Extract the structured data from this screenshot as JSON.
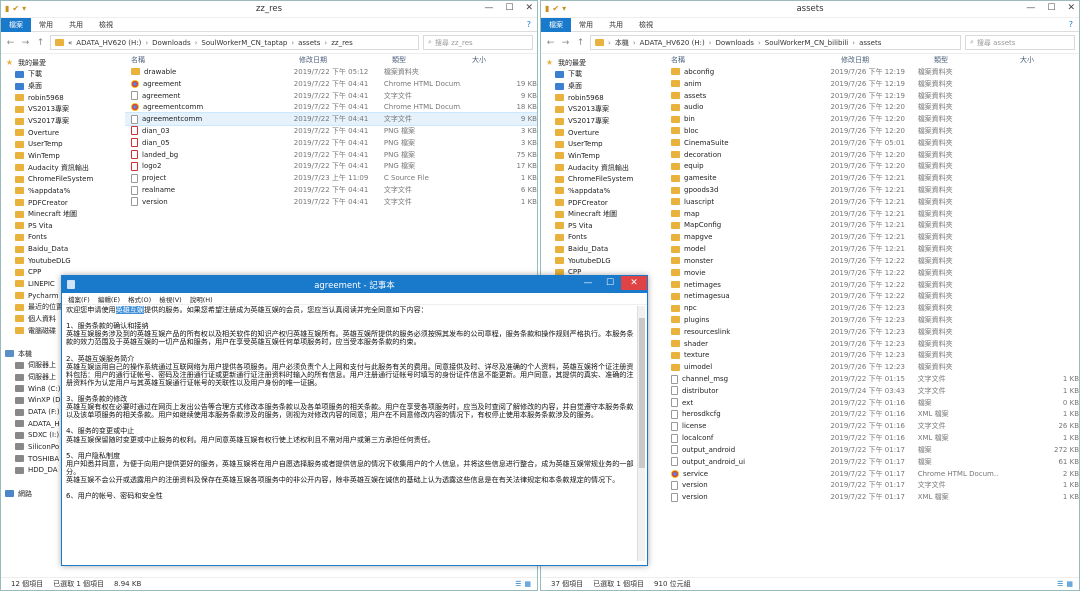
{
  "left": {
    "title": "zz_res",
    "ribbon": [
      "檔案",
      "常用",
      "共用",
      "檢視"
    ],
    "path": [
      "«",
      "ADATA_HV620 (H:)",
      "Downloads",
      "SoulWorkerM_CN_taptap",
      "assets",
      "zz_res"
    ],
    "search_placeholder": "搜尋 zz_res",
    "headers": {
      "name": "名稱",
      "date": "修改日期",
      "type": "類型",
      "size": "大小"
    },
    "nav": [
      "我的最愛",
      "下載",
      "桌面",
      "robin5968",
      "VS2013專案",
      "VS2017專案",
      "Overture",
      "UserTemp",
      "WinTemp",
      "Audacity 資訊輸出",
      "ChromeFileSystem",
      "%appdata%",
      "PDFCreator",
      "Minecraft 地圖",
      "PS Vita",
      "Fonts",
      "Baidu_Data",
      "YoutubeDLG",
      "CPP",
      "LINEPIC",
      "Pycharm",
      "最近的位置",
      "個人資料",
      "電腦磁碟",
      "",
      "本機",
      "伺服器上",
      "伺服器上",
      "Win8 (C:)",
      "WinXP (D:)",
      "DATA (F:)",
      "ADATA_H",
      "SDXC (I:)",
      "SiliconPo",
      "TOSHIBA",
      "HDD_DA",
      "",
      "網路"
    ],
    "files": [
      {
        "name": "drawable",
        "date": "2019/7/22 下午 05:12",
        "type": "檔案資料夾",
        "size": "",
        "icon": "folder"
      },
      {
        "name": "agreement",
        "date": "2019/7/22 下午 04:41",
        "type": "Chrome HTML Docum...",
        "size": "19 KB",
        "icon": "chrome"
      },
      {
        "name": "agreement",
        "date": "2019/7/22 下午 04:41",
        "type": "文字文件",
        "size": "9 KB",
        "icon": "file"
      },
      {
        "name": "agreementcomm",
        "date": "2019/7/22 下午 04:41",
        "type": "Chrome HTML Docum...",
        "size": "18 KB",
        "icon": "chrome"
      },
      {
        "name": "agreementcomm",
        "date": "2019/7/22 下午 04:41",
        "type": "文字文件",
        "size": "9 KB",
        "icon": "file",
        "selected": true
      },
      {
        "name": "dian_03",
        "date": "2019/7/22 下午 04:41",
        "type": "PNG 檔案",
        "size": "3 KB",
        "icon": "png"
      },
      {
        "name": "dian_05",
        "date": "2019/7/22 下午 04:41",
        "type": "PNG 檔案",
        "size": "3 KB",
        "icon": "png"
      },
      {
        "name": "landed_bg",
        "date": "2019/7/22 下午 04:41",
        "type": "PNG 檔案",
        "size": "75 KB",
        "icon": "png"
      },
      {
        "name": "logo2",
        "date": "2019/7/22 下午 04:41",
        "type": "PNG 檔案",
        "size": "17 KB",
        "icon": "png"
      },
      {
        "name": "project",
        "date": "2019/7/23 上午 11:09",
        "type": "C Source File",
        "size": "1 KB",
        "icon": "file"
      },
      {
        "name": "realname",
        "date": "2019/7/22 下午 04:41",
        "type": "文字文件",
        "size": "6 KB",
        "icon": "file"
      },
      {
        "name": "version",
        "date": "2019/7/22 下午 04:41",
        "type": "文字文件",
        "size": "1 KB",
        "icon": "file"
      }
    ],
    "status": {
      "count": "12 個項目",
      "selected": "已選取 1 個項目",
      "size": "8.94 KB"
    }
  },
  "right": {
    "title": "assets",
    "ribbon": [
      "檔案",
      "常用",
      "共用",
      "檢視"
    ],
    "path": [
      "本機",
      "ADATA_HV620 (H:)",
      "Downloads",
      "SoulWorkerM_CN_bilibili",
      "assets"
    ],
    "search_placeholder": "搜尋 assets",
    "headers": {
      "name": "名稱",
      "date": "修改日期",
      "type": "類型",
      "size": "大小"
    },
    "nav": [
      "我的最愛",
      "下載",
      "桌面",
      "robin5968",
      "VS2013專案",
      "VS2017專案",
      "Overture",
      "UserTemp",
      "WinTemp",
      "Audacity 資訊輸出",
      "ChromeFileSystem",
      "%appdata%",
      "PDFCreator",
      "Minecraft 地圖",
      "PS Vita",
      "Fonts",
      "Baidu_Data",
      "YoutubeDLG",
      "CPP"
    ],
    "files": [
      {
        "name": "abconfig",
        "date": "2019/7/26 下午 12:19",
        "type": "檔案資料夾",
        "size": "",
        "icon": "folder"
      },
      {
        "name": "anim",
        "date": "2019/7/26 下午 12:19",
        "type": "檔案資料夾",
        "size": "",
        "icon": "folder"
      },
      {
        "name": "assets",
        "date": "2019/7/26 下午 12:19",
        "type": "檔案資料夾",
        "size": "",
        "icon": "folder"
      },
      {
        "name": "audio",
        "date": "2019/7/26 下午 12:20",
        "type": "檔案資料夾",
        "size": "",
        "icon": "folder"
      },
      {
        "name": "bin",
        "date": "2019/7/26 下午 12:20",
        "type": "檔案資料夾",
        "size": "",
        "icon": "folder"
      },
      {
        "name": "bloc",
        "date": "2019/7/26 下午 12:20",
        "type": "檔案資料夾",
        "size": "",
        "icon": "folder"
      },
      {
        "name": "CinemaSuite",
        "date": "2019/7/26 下午 05:01",
        "type": "檔案資料夾",
        "size": "",
        "icon": "folder"
      },
      {
        "name": "decoration",
        "date": "2019/7/26 下午 12:20",
        "type": "檔案資料夾",
        "size": "",
        "icon": "folder"
      },
      {
        "name": "equip",
        "date": "2019/7/26 下午 12:20",
        "type": "檔案資料夾",
        "size": "",
        "icon": "folder"
      },
      {
        "name": "gamesite",
        "date": "2019/7/26 下午 12:21",
        "type": "檔案資料夾",
        "size": "",
        "icon": "folder"
      },
      {
        "name": "gpoods3d",
        "date": "2019/7/26 下午 12:21",
        "type": "檔案資料夾",
        "size": "",
        "icon": "folder"
      },
      {
        "name": "luascript",
        "date": "2019/7/26 下午 12:21",
        "type": "檔案資料夾",
        "size": "",
        "icon": "folder"
      },
      {
        "name": "map",
        "date": "2019/7/26 下午 12:21",
        "type": "檔案資料夾",
        "size": "",
        "icon": "folder"
      },
      {
        "name": "MapConfig",
        "date": "2019/7/26 下午 12:21",
        "type": "檔案資料夾",
        "size": "",
        "icon": "folder"
      },
      {
        "name": "mapgve",
        "date": "2019/7/26 下午 12:21",
        "type": "檔案資料夾",
        "size": "",
        "icon": "folder"
      },
      {
        "name": "model",
        "date": "2019/7/26 下午 12:21",
        "type": "檔案資料夾",
        "size": "",
        "icon": "folder"
      },
      {
        "name": "monster",
        "date": "2019/7/26 下午 12:22",
        "type": "檔案資料夾",
        "size": "",
        "icon": "folder"
      },
      {
        "name": "movie",
        "date": "2019/7/26 下午 12:22",
        "type": "檔案資料夾",
        "size": "",
        "icon": "folder"
      },
      {
        "name": "netimages",
        "date": "2019/7/26 下午 12:22",
        "type": "檔案資料夾",
        "size": "",
        "icon": "folder"
      },
      {
        "name": "netimagesua",
        "date": "2019/7/26 下午 12:22",
        "type": "檔案資料夾",
        "size": "",
        "icon": "folder"
      },
      {
        "name": "npc",
        "date": "2019/7/26 下午 12:23",
        "type": "檔案資料夾",
        "size": "",
        "icon": "folder"
      },
      {
        "name": "plugins",
        "date": "2019/7/26 下午 12:23",
        "type": "檔案資料夾",
        "size": "",
        "icon": "folder"
      },
      {
        "name": "resourceslink",
        "date": "2019/7/26 下午 12:23",
        "type": "檔案資料夾",
        "size": "",
        "icon": "folder"
      },
      {
        "name": "shader",
        "date": "2019/7/26 下午 12:23",
        "type": "檔案資料夾",
        "size": "",
        "icon": "folder"
      },
      {
        "name": "texture",
        "date": "2019/7/26 下午 12:23",
        "type": "檔案資料夾",
        "size": "",
        "icon": "folder"
      },
      {
        "name": "uimodel",
        "date": "2019/7/26 下午 12:23",
        "type": "檔案資料夾",
        "size": "",
        "icon": "folder"
      },
      {
        "name": "channel_msg",
        "date": "2019/7/22 下午 01:15",
        "type": "文字文件",
        "size": "1 KB",
        "icon": "file"
      },
      {
        "name": "distributor",
        "date": "2019/7/24 下午 03:43",
        "type": "文字文件",
        "size": "1 KB",
        "icon": "file"
      },
      {
        "name": "ext",
        "date": "2019/7/22 下午 01:16",
        "type": "檔案",
        "size": "0 KB",
        "icon": "file"
      },
      {
        "name": "herosdkcfg",
        "date": "2019/7/22 下午 01:16",
        "type": "XML 檔案",
        "size": "1 KB",
        "icon": "file"
      },
      {
        "name": "license",
        "date": "2019/7/22 下午 01:16",
        "type": "文字文件",
        "size": "26 KB",
        "icon": "file"
      },
      {
        "name": "localconf",
        "date": "2019/7/22 下午 01:16",
        "type": "XML 檔案",
        "size": "1 KB",
        "icon": "file"
      },
      {
        "name": "output_android",
        "date": "2019/7/22 下午 01:17",
        "type": "檔案",
        "size": "272 KB",
        "icon": "file"
      },
      {
        "name": "output_android_ui",
        "date": "2019/7/22 下午 01:17",
        "type": "檔案",
        "size": "61 KB",
        "icon": "file"
      },
      {
        "name": "service",
        "date": "2019/7/22 下午 01:17",
        "type": "Chrome HTML Docum...",
        "size": "2 KB",
        "icon": "chrome"
      },
      {
        "name": "version",
        "date": "2019/7/22 下午 01:17",
        "type": "文字文件",
        "size": "1 KB",
        "icon": "file"
      },
      {
        "name": "version",
        "date": "2019/7/22 下午 01:17",
        "type": "XML 檔案",
        "size": "1 KB",
        "icon": "file"
      }
    ],
    "status": {
      "count": "37 個項目",
      "selected": "已選取 1 個項目",
      "size": "910 位元組"
    }
  },
  "notepad": {
    "title": "agreement - 記事本",
    "menu": [
      "檔案(F)",
      "編輯(E)",
      "格式(O)",
      "檢視(V)",
      "說明(H)"
    ],
    "lines": [
      {
        "pre": "欢迎您申请使用",
        "hl": "英雄互娱",
        "post": "提供的服务。如果您希望注册成为英雄互娱的会员，您应当认真阅读并完全同意如下内容："
      },
      {
        "pre": "",
        "hl": "",
        "post": ""
      },
      {
        "pre": "1、服务条款的确认和接纳",
        "hl": "",
        "post": ""
      },
      {
        "pre": "        英雄互娱服务涉及到的英雄互娱产品的所有权以及相关软件的知识产权归英雄互娱所有。英雄互娱所提供的服务必须按照其发布的公司章程，服务条款和操作规则严格执行。本服务条款的效力范围及于英雄互娱的一切产品和服务，用户在享受英雄互娱任何单项服务时，应当受本服务条款的约束。",
        "hl": "",
        "post": ""
      },
      {
        "pre": "",
        "hl": "",
        "post": ""
      },
      {
        "pre": "2、英雄互娱服务简介",
        "hl": "",
        "post": ""
      },
      {
        "pre": "        英雄互娱运用自己的操作系统通过互联网络为用户提供各项服务。用户必须负责个人上网和支付与此服务有关的费用。同意接供及时、详尽及准确的个人资料，英雄互娱将个证注册资料包括：用户的通行证帐号、密码及注册通行证或更新通行证注册资料时输入的所有信息。用户注册通行证帐号时填写的身份证件信息不能更新。用户同意，其提供的真实、准确的注册资料作为认定用户与其英雄互娱通行证帐号的关联性以及用户身份的唯一证据。",
        "hl": "",
        "post": ""
      },
      {
        "pre": "",
        "hl": "",
        "post": ""
      },
      {
        "pre": "3、服务条款的修改",
        "hl": "",
        "post": ""
      },
      {
        "pre": "        英雄互娱有权在必要时通过在网页上发出公告等合理方式修改本服务条款以及各单项服务的相关条款。用户在享受各项服务时，应当及时查阅了解修改的内容，并自觉遵守本服务条款以及该单项服务的相关条款。用户如继续使用本服务条款涉及的服务，则视为对修改内容的同意；用户在不同意修改内容的情况下，有权停止使用本服务条款涉及的服务。",
        "hl": "",
        "post": ""
      },
      {
        "pre": "",
        "hl": "",
        "post": ""
      },
      {
        "pre": "4、服务的变更或中止",
        "hl": "",
        "post": ""
      },
      {
        "pre": "        英雄互娱保留随时变更或中止服务的权利。用户同意英雄互娱有权行使上述权利且不需对用户或第三方承担任何责任。",
        "hl": "",
        "post": ""
      },
      {
        "pre": "",
        "hl": "",
        "post": ""
      },
      {
        "pre": "5、用户隐私制度",
        "hl": "",
        "post": ""
      },
      {
        "pre": "        用户知悉并同意，为便于向用户提供更好的服务，英雄互娱将在用户自愿选择服务或者提供信息的情况下收集用户的个人信息，并将这些信息进行整合，成为英雄互娱常规业务的一部分。",
        "hl": "",
        "post": ""
      },
      {
        "pre": "        英雄互娱不会公开或透露用户的注册资料及保存在英雄互娱各项服务中的非公开内容，除非英雄互娱在诚信的基础上认为透露这些信息是在有关法律规定和本条款规定的情况下。",
        "hl": "",
        "post": ""
      },
      {
        "pre": "",
        "hl": "",
        "post": ""
      },
      {
        "pre": "6、用户的帐号、密码和安全性",
        "hl": "",
        "post": ""
      }
    ]
  },
  "colors": {
    "accent": "#1979ca",
    "folder": "#e8b23c",
    "selection": "#e5f1fb",
    "close": "#e04343"
  }
}
